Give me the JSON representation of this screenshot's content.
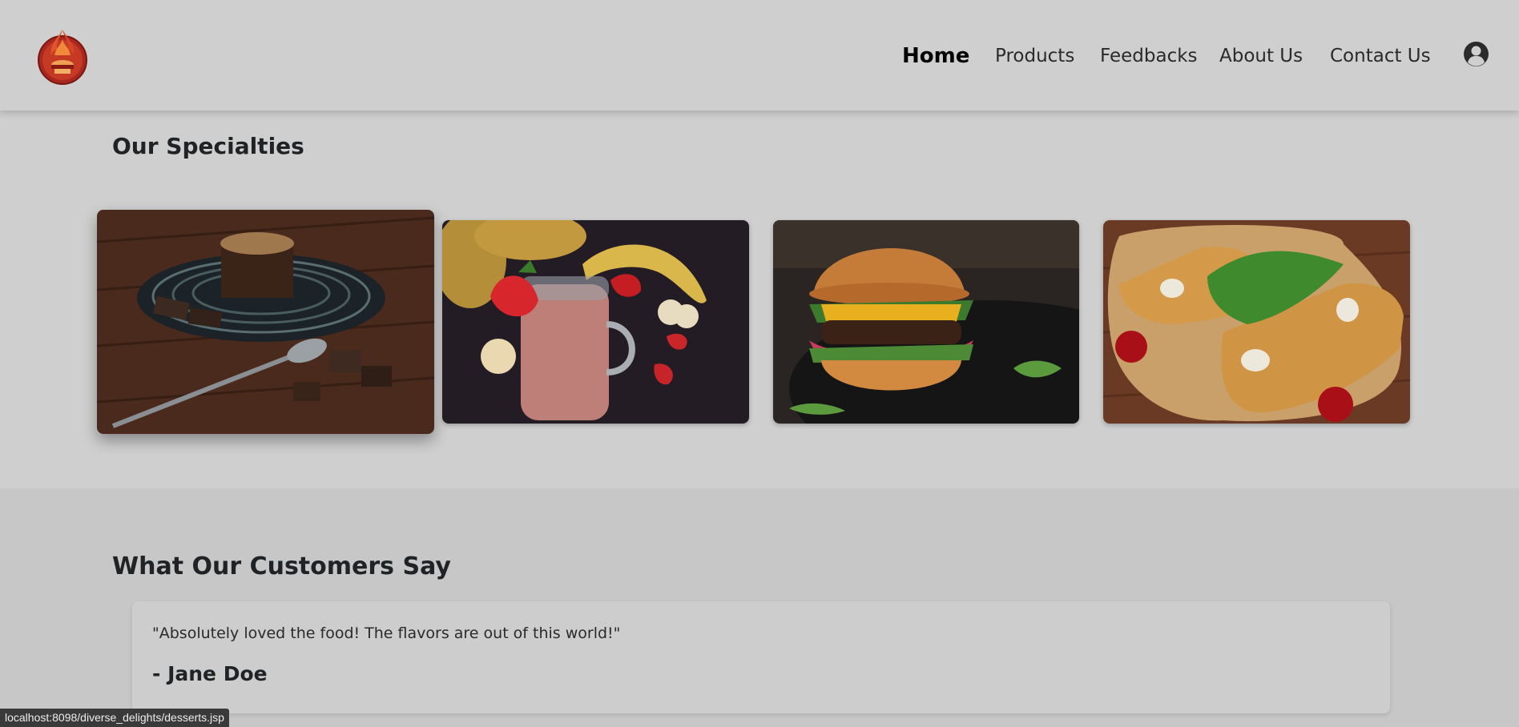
{
  "header": {
    "logo_name": "flame-logo",
    "nav": [
      {
        "label": "Home",
        "active": true
      },
      {
        "label": "Products",
        "active": false
      },
      {
        "label": "Feedbacks",
        "active": false
      },
      {
        "label": "About Us",
        "active": false
      },
      {
        "label": "Contact Us",
        "active": false
      }
    ],
    "user_icon": "user-circle-icon"
  },
  "specialties": {
    "title": "Our Specialties",
    "items": [
      {
        "name": "chocolate-lava-cake",
        "hovered": true
      },
      {
        "name": "strawberry-smoothie",
        "hovered": false
      },
      {
        "name": "burger",
        "hovered": false
      },
      {
        "name": "garlic-bread",
        "hovered": false
      }
    ]
  },
  "testimonials": {
    "title": "What Our Customers Say",
    "items": [
      {
        "quote": "\"Absolutely loved the food! The flavors are out of this world!\"",
        "author": "- Jane Doe"
      }
    ]
  },
  "status_bar": {
    "url": "localhost:8098/diverse_delights/desserts.jsp"
  },
  "colors": {
    "background": "#cfcfcf",
    "section_alt": "#c7c7c7",
    "logo_red": "#b3261e",
    "status_bar": "#3a3a3a"
  }
}
